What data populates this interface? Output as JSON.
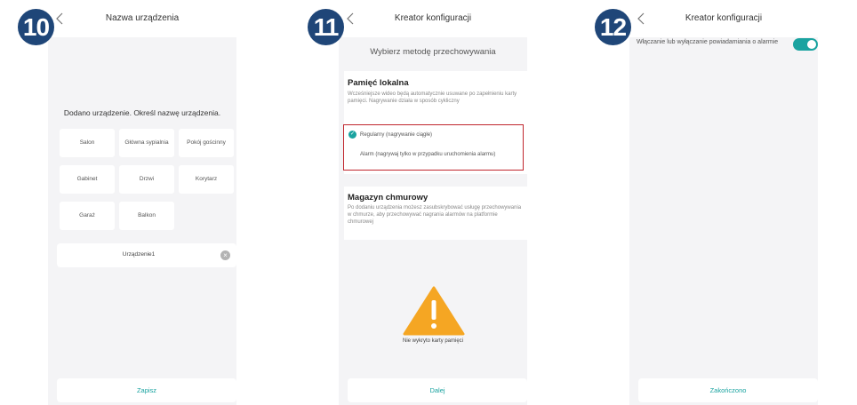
{
  "badges": [
    "10",
    "11",
    "12"
  ],
  "screen10": {
    "title": "Nazwa urządzenia",
    "prompt": "Dodano urządzenie. Określ nazwę urządzenia.",
    "rooms": [
      "Salon",
      "Główna sypialnia",
      "Pokój gościnny",
      "Gabinet",
      "Drzwi",
      "Korytarz",
      "Garaż",
      "Balkon"
    ],
    "device_name_value": "Urządzenie1",
    "save_label": "Zapisz"
  },
  "screen11": {
    "title": "Kreator konfiguracji",
    "subtitle": "Wybierz metodę przechowywania",
    "local": {
      "title": "Pamięć lokalna",
      "description": "Wcześniejsze wideo będą automatycznie usuwane po zapełnieniu karty pamięci. Nagrywanie działa w sposób cykliczny",
      "option_regular": "Regularny (nagrywanie ciągłe)",
      "option_alarm": "Alarm (nagrywaj tylko w przypadku uruchomienia alarmu)"
    },
    "cloud": {
      "title": "Magazyn chmurowy",
      "description": "Po dodaniu urządzenia możesz zasubskrybować usługę przechowywania w chmurze, aby przechowywać nagrania alarmów na platformie chmurowej"
    },
    "no_card_text": "Nie wykryto karty pamięci",
    "next_label": "Dalej"
  },
  "screen12": {
    "title": "Kreator konfiguracji",
    "alarm_toggle_label": "Włączanie lub wyłączanie powiadamiania o alarmie",
    "alarm_toggle_on": true,
    "finish_label": "Zakończono"
  },
  "colors": {
    "accent": "#1aa3a0",
    "badge": "#1f4678",
    "highlight": "#c0262d",
    "warning": "#f5a623"
  },
  "icons": [
    "back-arrow-icon",
    "clear-icon",
    "check-icon",
    "warning-icon"
  ]
}
